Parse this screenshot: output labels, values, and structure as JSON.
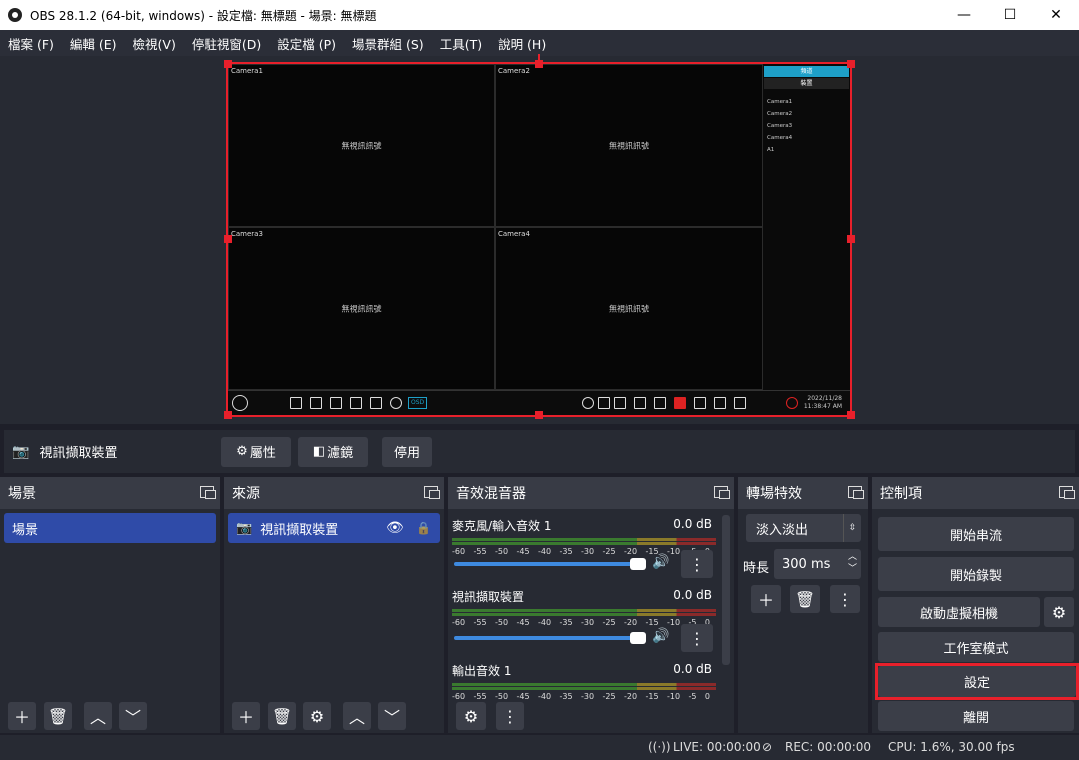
{
  "window": {
    "title": "OBS 28.1.2 (64-bit, windows) - 設定檔: 無標題 - 場景: 無標題",
    "minimize": "—",
    "maximize": "☐",
    "close": "✕"
  },
  "menu": [
    "檔案 (F)",
    "編輯 (E)",
    "檢視(V)",
    "停駐視窗(D)",
    "設定檔 (P)",
    "場景群組 (S)",
    "工具(T)",
    "說明 (H)"
  ],
  "preview": {
    "cells": [
      {
        "label": "Camera1",
        "text": "無視訊訊號"
      },
      {
        "label": "Camera2",
        "text": "無視訊訊號"
      },
      {
        "label": "Camera3",
        "text": "無視訊訊號"
      },
      {
        "label": "Camera4",
        "text": "無視訊訊號"
      }
    ],
    "panel_tabs": [
      "頻道",
      "裝置"
    ],
    "panel_items": [
      "Camera1",
      "Camera2",
      "Camera3",
      "Camera4",
      "A1"
    ],
    "osd_label": "OSD",
    "datetime": [
      "2022/11/28",
      "11:38:47 AM"
    ]
  },
  "source_bar": {
    "selected": "視訊擷取裝置",
    "properties": "屬性",
    "filters": "濾鏡",
    "deactivate": "停用"
  },
  "scenes": {
    "title": "場景",
    "items": [
      "場景"
    ]
  },
  "sources": {
    "title": "來源",
    "items": [
      "視訊擷取裝置"
    ]
  },
  "mixer": {
    "title": "音效混音器",
    "ticks": [
      "-60",
      "-55",
      "-50",
      "-45",
      "-40",
      "-35",
      "-30",
      "-25",
      "-20",
      "-15",
      "-10",
      "-5",
      "0"
    ],
    "channels": [
      {
        "name": "麥克風/輸入音效 1",
        "db": "0.0 dB",
        "volume": 1.0
      },
      {
        "name": "視訊擷取裝置",
        "db": "0.0 dB",
        "volume": 1.0
      },
      {
        "name": "輸出音效 1",
        "db": "0.0 dB",
        "volume": 1.0
      }
    ]
  },
  "transitions": {
    "title": "轉場特效",
    "selected": "淡入淡出",
    "duration_label": "時長",
    "duration": "300 ms"
  },
  "controls": {
    "title": "控制項",
    "start_streaming": "開始串流",
    "start_recording": "開始錄製",
    "start_virtualcam": "啟動虛擬相機",
    "studio_mode": "工作室模式",
    "settings": "設定",
    "exit": "離開",
    "highlight_color": "#e8202b"
  },
  "status": {
    "live": "LIVE: 00:00:00",
    "rec": "REC: 00:00:00",
    "cpu": "CPU: 1.6%, 30.00 fps"
  }
}
